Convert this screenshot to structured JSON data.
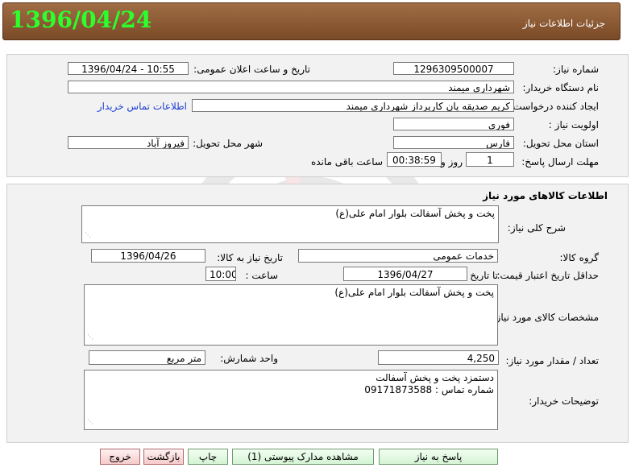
{
  "header": {
    "title": "جزئیات اطلاعات نیاز",
    "date": "1396/04/24"
  },
  "info": {
    "need_number_label": "شماره نیاز:",
    "need_number": "1296309500007",
    "announce_label": "تاریخ و ساعت اعلان عمومی:",
    "announce_value": "1396/04/24 - 10:55",
    "buyer_label": "نام دستگاه خریدار:",
    "buyer_value": "شهرداری میمند",
    "creator_label": "ایجاد کننده درخواست:",
    "creator_value": "کریم  صدیقه پان  کارپرداز شهرداری میمند",
    "contact_link": "اطلاعات تماس خریدار",
    "priority_label": "اولویت نیاز :",
    "priority_value": "فوری",
    "province_label": "استان محل تحویل:",
    "province_value": "فارس",
    "city_label": "شهر محل تحویل:",
    "city_value": "فیروز آباد",
    "deadline_label": "مهلت ارسال پاسخ:",
    "days_value": "1",
    "days_unit": "روز و",
    "time_value": "00:38:59",
    "remaining_label": "ساعت باقی مانده"
  },
  "goods": {
    "section_title": "اطلاعات کالاهای مورد نیاز",
    "summary_label": "شرح کلی نیاز:",
    "summary_value": "پخت و پخش آسفالت بلوار امام علی(ع)",
    "group_label": "گروه کالا:",
    "group_value": "خدمات عمومی",
    "need_date_label": "تاریخ نیاز به کالا:",
    "need_date_value": "1396/04/26",
    "min_validity_label": "حداقل تاریخ اعتبار قیمت:",
    "until_date_label": "تا تاریخ :",
    "until_date_value": "1396/04/27",
    "time_label": "ساعت :",
    "time_value": "10:00",
    "specs_label": "مشخصات کالای مورد نیاز:",
    "specs_value": "پخت و پخش آسفالت بلوار امام علی(ع)",
    "qty_label": "تعداد / مقدار مورد نیاز:",
    "qty_value": "4,250",
    "unit_label": "واحد شمارش:",
    "unit_value": "متر مربع",
    "buyer_notes_label": "توضیحات خریدار:",
    "buyer_notes_line1": "دستمزد پخت و پخش آسفالت",
    "buyer_notes_line2": "شماره تماس : 09171873588"
  },
  "buttons": {
    "reply": "پاسخ به نیاز",
    "attachments": "مشاهده مدارک پیوستی (1)",
    "print": "چاپ",
    "back": "بازگشت",
    "exit": "خروج"
  },
  "colors": {
    "header_bg": "#8b5a33",
    "header_date": "#2cff2c",
    "panel_bg": "#f2f2f2",
    "link": "#1f3fd6"
  }
}
